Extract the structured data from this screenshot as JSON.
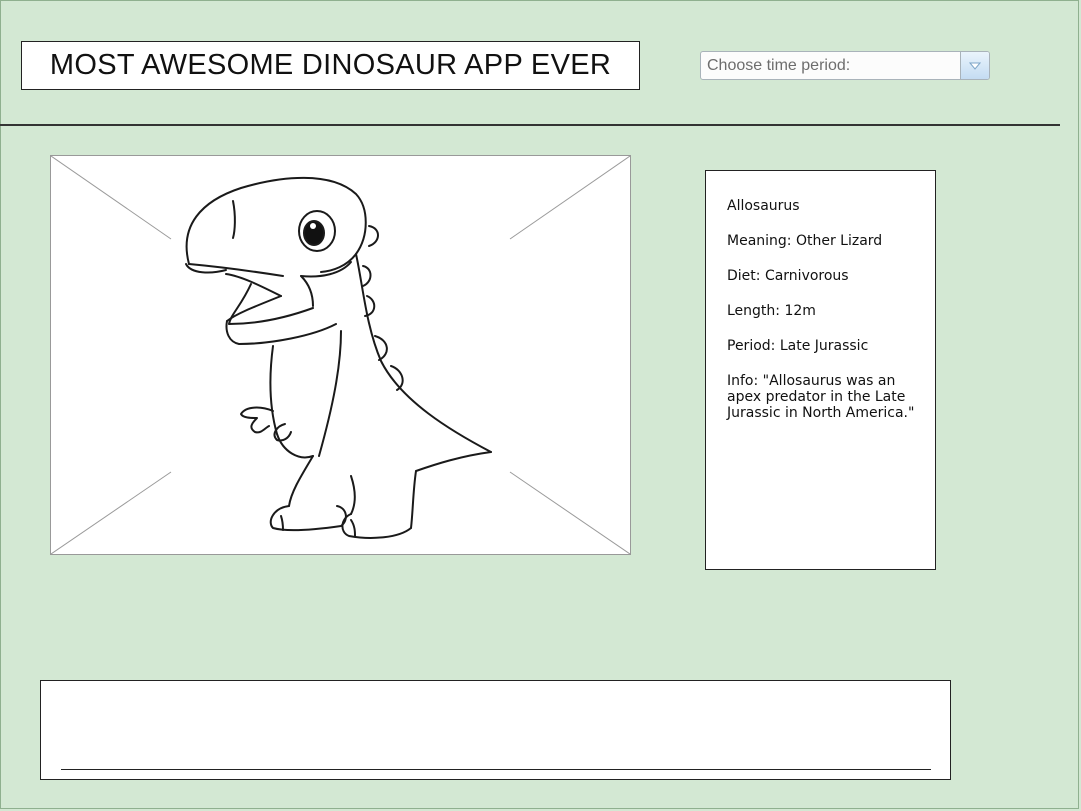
{
  "header": {
    "title": "MOST AWESOME DINOSAUR APP EVER"
  },
  "period_select": {
    "value": "Choose time period:"
  },
  "dinosaur": {
    "name": "Allosaurus",
    "meaning": "Meaning: Other Lizard",
    "diet": "Diet: Carnivorous",
    "length": "Length: 12m",
    "period": "Period: Late Jurassic",
    "info": "Info: \"Allosaurus was an apex predator in the Late Jurassic in North America.\""
  },
  "colors": {
    "background": "#d3e8d3",
    "dropdown_arrow": "#c4dcf2"
  }
}
